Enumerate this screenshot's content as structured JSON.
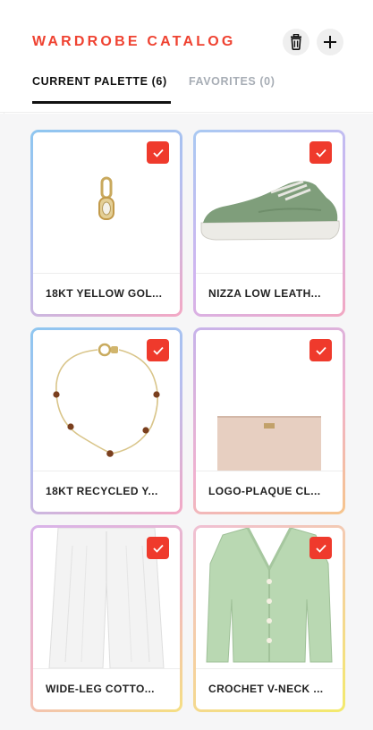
{
  "header": {
    "title": "WARDROBE CATALOG",
    "actions": [
      {
        "icon": "trash-icon"
      },
      {
        "icon": "plus-icon"
      }
    ]
  },
  "tabs": [
    {
      "label": "CURRENT PALETTE (6)",
      "active": true
    },
    {
      "label": "FAVORITES (0)",
      "active": false
    }
  ],
  "items": [
    {
      "label": "18KT YELLOW GOL...",
      "checked": true,
      "image": "gold pendant charm"
    },
    {
      "label": "NIZZA LOW LEATH...",
      "checked": true,
      "image": "green low-top sneaker"
    },
    {
      "label": "18KT RECYCLED Y...",
      "checked": true,
      "image": "gold chain necklace with brown beads"
    },
    {
      "label": "LOGO-PLAQUE CL...",
      "checked": true,
      "image": "blush leather clutch"
    },
    {
      "label": "WIDE-LEG COTTO...",
      "checked": true,
      "image": "white wide-leg trousers"
    },
    {
      "label": "CROCHET V-NECK ...",
      "checked": true,
      "image": "mint crochet cardigan"
    }
  ],
  "colors": {
    "accent": "#ef4231",
    "check_bg": "#ef3a2c",
    "tab_active": "#111111",
    "tab_inactive": "#a7adb5",
    "grid_bg": "#f6f6f7"
  }
}
